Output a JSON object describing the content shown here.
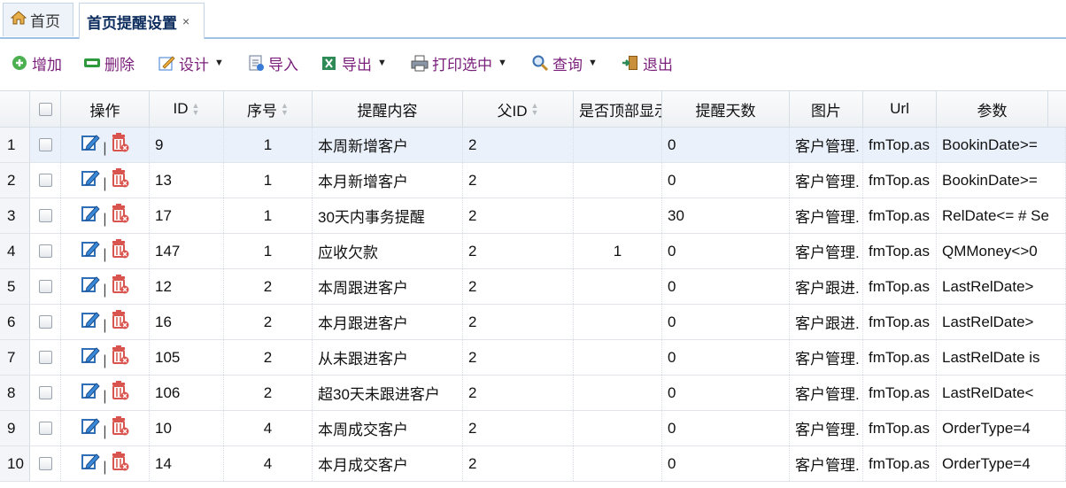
{
  "tabs": [
    {
      "label": "首页",
      "icon": "home-icon"
    },
    {
      "label": "首页提醒设置",
      "close": "×"
    }
  ],
  "toolbar": [
    {
      "label": "增加",
      "icon": "add-icon",
      "dropdown": false
    },
    {
      "label": "删除",
      "icon": "delete-icon",
      "dropdown": false
    },
    {
      "label": "设计",
      "icon": "design-icon",
      "dropdown": true
    },
    {
      "label": "导入",
      "icon": "import-icon",
      "dropdown": false
    },
    {
      "label": "导出",
      "icon": "export-icon",
      "dropdown": true
    },
    {
      "label": "打印选中",
      "icon": "print-icon",
      "dropdown": true
    },
    {
      "label": "查询",
      "icon": "search-icon",
      "dropdown": true
    },
    {
      "label": "退出",
      "icon": "exit-icon",
      "dropdown": false
    }
  ],
  "columns": [
    "操作",
    "ID",
    "序号",
    "提醒内容",
    "父ID",
    "是否顶部显示",
    "提醒天数",
    "图片",
    "Url",
    "参数"
  ],
  "rows": [
    {
      "n": "1",
      "id": "9",
      "seq": "1",
      "content": "本周新增客户",
      "pid": "2",
      "top": "",
      "days": "0",
      "pic": "客户管理.",
      "url": "fmTop.as",
      "param": "BookinDate>="
    },
    {
      "n": "2",
      "id": "13",
      "seq": "1",
      "content": "本月新增客户",
      "pid": "2",
      "top": "",
      "days": "0",
      "pic": "客户管理.",
      "url": "fmTop.as",
      "param": "BookinDate>="
    },
    {
      "n": "3",
      "id": "17",
      "seq": "1",
      "content": "30天内事务提醒",
      "pid": "2",
      "top": "",
      "days": "30",
      "pic": "客户管理.",
      "url": "fmTop.as",
      "param": "RelDate<= #  Se"
    },
    {
      "n": "4",
      "id": "147",
      "seq": "1",
      "content": "应收欠款",
      "pid": "2",
      "top": "1",
      "days": "0",
      "pic": "客户管理.",
      "url": "fmTop.as",
      "param": "QMMoney<>0"
    },
    {
      "n": "5",
      "id": "12",
      "seq": "2",
      "content": "本周跟进客户",
      "pid": "2",
      "top": "",
      "days": "0",
      "pic": "客户跟进.",
      "url": "fmTop.as",
      "param": "LastRelDate>"
    },
    {
      "n": "6",
      "id": "16",
      "seq": "2",
      "content": "本月跟进客户",
      "pid": "2",
      "top": "",
      "days": "0",
      "pic": "客户跟进.",
      "url": "fmTop.as",
      "param": "LastRelDate>"
    },
    {
      "n": "7",
      "id": "105",
      "seq": "2",
      "content": "从未跟进客户",
      "pid": "2",
      "top": "",
      "days": "0",
      "pic": "客户管理.",
      "url": "fmTop.as",
      "param": "LastRelDate is"
    },
    {
      "n": "8",
      "id": "106",
      "seq": "2",
      "content": "超30天未跟进客户",
      "pid": "2",
      "top": "",
      "days": "0",
      "pic": "客户管理.",
      "url": "fmTop.as",
      "param": "LastRelDate<"
    },
    {
      "n": "9",
      "id": "10",
      "seq": "4",
      "content": "本周成交客户",
      "pid": "2",
      "top": "",
      "days": "0",
      "pic": "客户管理.",
      "url": "fmTop.as",
      "param": "OrderType=4"
    },
    {
      "n": "10",
      "id": "14",
      "seq": "4",
      "content": "本月成交客户",
      "pid": "2",
      "top": "",
      "days": "0",
      "pic": "客户管理.",
      "url": "fmTop.as",
      "param": "OrderType=4"
    }
  ],
  "colors": {
    "accent": "#7a1f7a",
    "tab_border": "#9fc2e4",
    "selected_row": "#eaf1fb"
  }
}
